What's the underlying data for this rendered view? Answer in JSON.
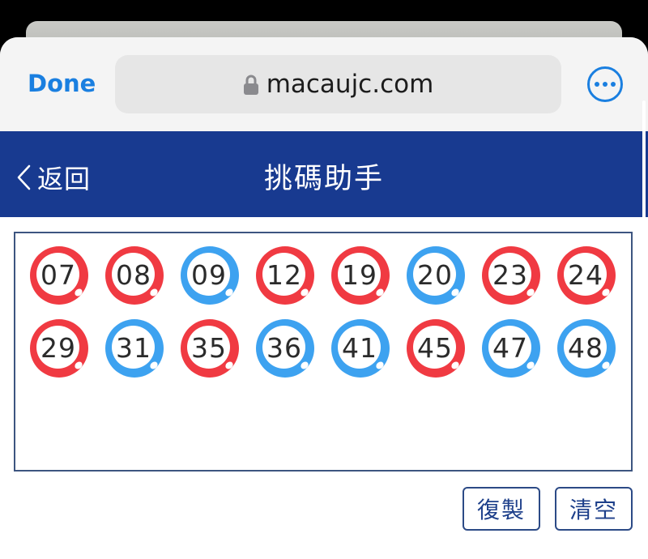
{
  "browser": {
    "done_label": "Done",
    "url": "macaujc.com",
    "more_icon": "ellipsis-circle-icon",
    "lock_icon": "lock-icon",
    "accent_color": "#1a7fe0"
  },
  "nav": {
    "back_label": "返回",
    "title": "挑碼助手",
    "bar_color": "#183a90"
  },
  "colors": {
    "red": "#f03a42",
    "blue": "#3da2f0"
  },
  "balls": [
    {
      "number": "07",
      "color": "red"
    },
    {
      "number": "08",
      "color": "red"
    },
    {
      "number": "09",
      "color": "blue"
    },
    {
      "number": "12",
      "color": "red"
    },
    {
      "number": "19",
      "color": "red"
    },
    {
      "number": "20",
      "color": "blue"
    },
    {
      "number": "23",
      "color": "red"
    },
    {
      "number": "24",
      "color": "red"
    },
    {
      "number": "29",
      "color": "red"
    },
    {
      "number": "31",
      "color": "blue"
    },
    {
      "number": "35",
      "color": "red"
    },
    {
      "number": "36",
      "color": "blue"
    },
    {
      "number": "41",
      "color": "blue"
    },
    {
      "number": "45",
      "color": "red"
    },
    {
      "number": "47",
      "color": "blue"
    },
    {
      "number": "48",
      "color": "blue"
    }
  ],
  "actions": {
    "copy_label": "復製",
    "clear_label": "清空"
  }
}
